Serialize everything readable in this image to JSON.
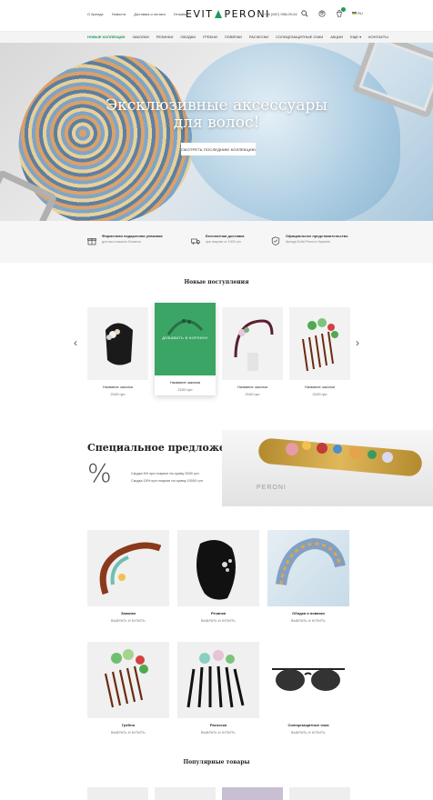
{
  "header": {
    "nav": [
      "О бренде",
      "Новости",
      "Доставка и оплата",
      "Отзывы"
    ],
    "logo_left": "EVIT",
    "logo_right": "PERONI",
    "phone": "+38 (067) 998-09-04",
    "lang": "RU",
    "icons": [
      "search-icon",
      "user-icon",
      "cart-icon",
      "flag-icon"
    ]
  },
  "categories": [
    "НОВЫЕ КОЛЛЕКЦИИ",
    "ЗАКОЛКИ",
    "РЕЗИНКИ",
    "ОБОДКИ",
    "ГРЕБНИ",
    "ПОВЯЗКИ",
    "РАСЧЕСКИ",
    "СОЛНЦЕЗАЩИТНЫЕ ОЧКИ",
    "АКЦИИ",
    "ЕЩЕ ▾",
    "КОНТАКТЫ"
  ],
  "hero": {
    "title": "Эксклюзивные аксессуары для волос!",
    "button": "СМОТРЕТЬ ПОСЛЕДНИЮ КОЛЛЕКЦИЮ"
  },
  "features": [
    {
      "title": "Фирменная подарочная упаковка",
      "sub": "для вас и вашего близкого"
    },
    {
      "title": "Бесплатная доставка",
      "sub": "при покупке от 1000 грн"
    },
    {
      "title": "Официальное представительство",
      "sub": "бренда Evita Peroni в Украине"
    }
  ],
  "new_arrivals": {
    "title": "Новые поступления",
    "overlay": "ДОБАВИТЬ В КОРЗИНУ",
    "items": [
      {
        "name": "Название заколки",
        "price": "2100 грн"
      },
      {
        "name": "Название заколки",
        "price": "2100 грн"
      },
      {
        "name": "Название заколки",
        "price": "2100 грн"
      },
      {
        "name": "Название заколки",
        "price": "2100 грн"
      }
    ]
  },
  "special": {
    "title": "Специальное предложение",
    "symbol": "%",
    "lines": [
      "Скидка 5% при покупке на сумму 5000 грн",
      "Скидка 15% при покупке на сумму 10000 грн"
    ],
    "brand": "PERONI"
  },
  "categories_grid": {
    "link": "ВЫБРАТЬ И КУПИТЬ",
    "items": [
      {
        "name": "Заколки"
      },
      {
        "name": "Резинки"
      },
      {
        "name": "Ободки и повязки"
      },
      {
        "name": "Гребни"
      },
      {
        "name": "Расчески"
      },
      {
        "name": "Солнцезащитные очки"
      }
    ]
  },
  "popular": {
    "title": "Популярные товары"
  },
  "colors": {
    "accent": "#1e9c5a",
    "card_hover": "#3aa565"
  }
}
